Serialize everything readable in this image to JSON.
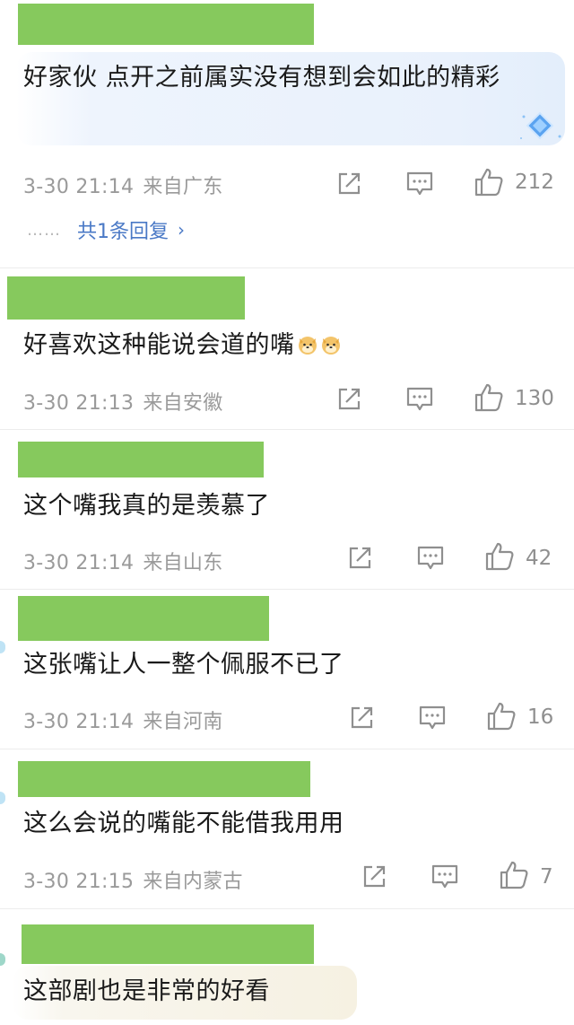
{
  "comments": [
    {
      "text": "好家伙 点开之前属实没有想到会如此的精彩",
      "time": "3-30 21:14",
      "location": "来自广东",
      "likes": "212",
      "reply": {
        "dots": "……",
        "label": "共1条回复",
        "chevron": "›"
      }
    },
    {
      "text": "好喜欢这种能说会道的嘴",
      "time": "3-30 21:13",
      "location": "来自安徽",
      "likes": "130"
    },
    {
      "text": "这个嘴我真的是羡慕了",
      "time": "3-30 21:14",
      "location": "来自山东",
      "likes": "42"
    },
    {
      "text": "这张嘴让人一整个佩服不已了",
      "time": "3-30 21:14",
      "location": "来自河南",
      "likes": "16"
    },
    {
      "text": "这么会说的嘴能不能借我用用",
      "time": "3-30 21:15",
      "location": "来自内蒙古",
      "likes": "7"
    },
    {
      "text": "这部剧也是非常的好看"
    }
  ],
  "icons": {
    "share": "share-icon",
    "comment": "comment-icon",
    "like": "thumbs-up-icon",
    "badge": "diamond-badge-icon",
    "emoji": "doge-emoji-icon"
  },
  "colors": {
    "username_redaction": "#86c95d",
    "link": "#4a79c6",
    "meta": "#9a9a9a",
    "bubble": "#e9f1fc"
  }
}
